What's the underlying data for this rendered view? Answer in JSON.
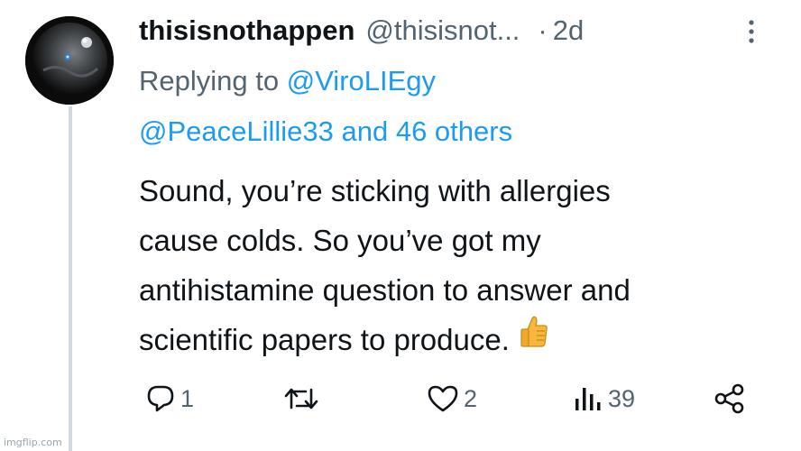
{
  "tweet": {
    "display_name": "thisisnothappen",
    "handle": "@thisisnot...",
    "separator": "·",
    "time": "2d",
    "reply_prefix": "Replying to",
    "reply_mention_1": "@ViroLIEgy",
    "reply_mention_2": "@PeaceLillie33 and 46 others",
    "text_lines": [
      "Sound, you’re sticking with allergies",
      "cause colds. So you’ve got my",
      "antihistamine question to answer and",
      "scientific papers to produce."
    ]
  },
  "actions": {
    "reply_count": "1",
    "retweet_count": "",
    "like_count": "2",
    "views_count": "39"
  },
  "icons": {
    "avatar": "globe-avatar",
    "more": "more-vertical-icon",
    "reply": "reply-icon",
    "retweet": "retweet-icon",
    "like": "heart-icon",
    "views": "views-icon",
    "share": "share-icon",
    "emoji": "thumbs-up-emoji"
  },
  "colors": {
    "text": "#0f1419",
    "secondary": "#536471",
    "link": "#1d9bf0",
    "thread_line": "#cfd9de"
  },
  "watermark": "imgflip.com"
}
